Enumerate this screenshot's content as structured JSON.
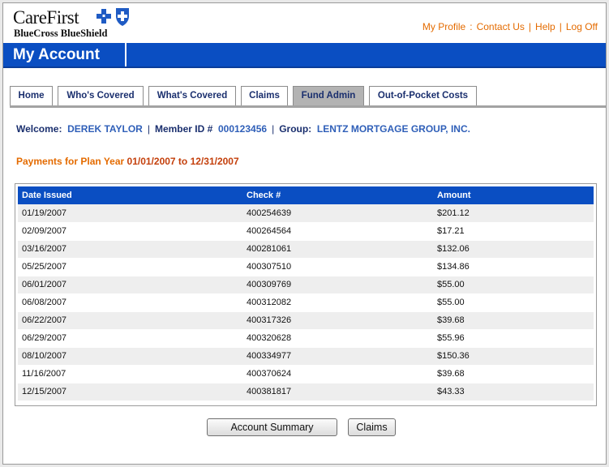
{
  "header": {
    "logo_word": "CareFirst",
    "logo_sub": "BlueCross BlueShield",
    "links": [
      "My Profile",
      "Contact Us",
      "Help",
      "Log Off"
    ],
    "separators": [
      ":",
      "|",
      "|"
    ]
  },
  "banner": {
    "title": "My Account"
  },
  "tabs": [
    {
      "label": "Home",
      "active": false
    },
    {
      "label": "Who's Covered",
      "active": false
    },
    {
      "label": "What's Covered",
      "active": false
    },
    {
      "label": "Claims",
      "active": false
    },
    {
      "label": "Fund Admin",
      "active": true
    },
    {
      "label": "Out-of-Pocket Costs",
      "active": false
    }
  ],
  "welcome": {
    "welcome_label": "Welcome:",
    "name": "DEREK TAYLOR",
    "member_label": "Member ID #",
    "member_id": "000123456",
    "group_label": "Group:",
    "group": "LENTZ MORTGAGE GROUP, INC."
  },
  "plan_year": {
    "prefix": "Payments for Plan Year",
    "range": "01/01/2007 to 12/31/2007"
  },
  "table": {
    "columns": [
      "Date Issued",
      "Check #",
      "Amount"
    ],
    "rows": [
      [
        "01/19/2007",
        "400254639",
        "$201.12"
      ],
      [
        "02/09/2007",
        "400264564",
        "$17.21"
      ],
      [
        "03/16/2007",
        "400281061",
        "$132.06"
      ],
      [
        "05/25/2007",
        "400307510",
        "$134.86"
      ],
      [
        "06/01/2007",
        "400309769",
        "$55.00"
      ],
      [
        "06/08/2007",
        "400312082",
        "$55.00"
      ],
      [
        "06/22/2007",
        "400317326",
        "$39.68"
      ],
      [
        "06/29/2007",
        "400320628",
        "$55.96"
      ],
      [
        "08/10/2007",
        "400334977",
        "$150.36"
      ],
      [
        "11/16/2007",
        "400370624",
        "$39.68"
      ],
      [
        "12/15/2007",
        "400381817",
        "$43.33"
      ]
    ]
  },
  "buttons": {
    "account_summary": "Account Summary",
    "claims": "Claims"
  },
  "colors": {
    "brand_blue": "#0a4ec2",
    "accent_orange": "#e46b00",
    "navy_text": "#1a2f6e"
  }
}
